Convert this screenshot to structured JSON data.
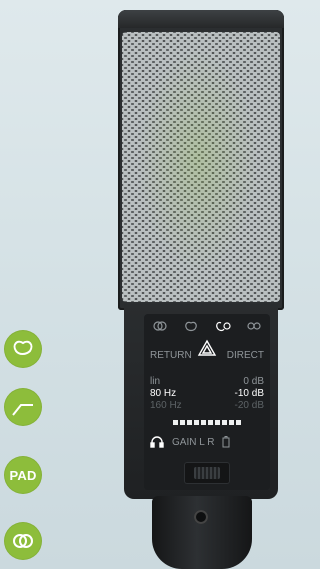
{
  "side_icons": [
    {
      "name": "cardioid-icon"
    },
    {
      "name": "low-cut-filter-icon"
    },
    {
      "name": "pad-icon",
      "label": "PAD"
    },
    {
      "name": "omni-figure8-icon"
    }
  ],
  "panel": {
    "return_label": "RETURN",
    "direct_label": "DIRECT",
    "hp_filter": [
      {
        "label": "lin",
        "value": "0 dB",
        "state": "dim-mid"
      },
      {
        "label": "80 Hz",
        "value": "-10 dB",
        "state": "active"
      },
      {
        "label": "160 Hz",
        "value": "-20 dB",
        "state": "dim"
      }
    ],
    "gain_label": "GAIN L R",
    "meter_segments": 10
  },
  "colors": {
    "accent": "#8dbd3b"
  }
}
